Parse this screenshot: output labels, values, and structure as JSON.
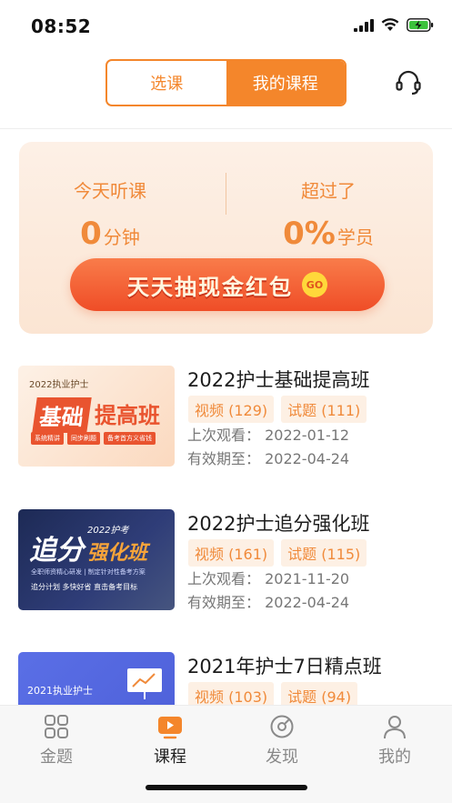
{
  "status_bar": {
    "time": "08:52"
  },
  "header": {
    "tabs": [
      {
        "label": "选课",
        "active": false
      },
      {
        "label": "我的课程",
        "active": true
      }
    ],
    "support_icon": "headset-icon"
  },
  "stats": {
    "today_label": "今天听课",
    "today_value": "0",
    "today_unit": "分钟",
    "beat_label": "超过了",
    "beat_value": "0%",
    "beat_unit": "学员",
    "cta_label": "天天抽现金红包",
    "cta_badge": "GO"
  },
  "courses": [
    {
      "title": "2022护士基础提高班",
      "video_tag": "视频 (129)",
      "quiz_tag": "试题 (111)",
      "last_watched": "上次观看： 2022-01-12",
      "expires": "有效期至： 2022-04-24",
      "thumb": {
        "top": "2022执业护士",
        "big_a": "基础",
        "big_b": "提高班",
        "pills": [
          "系统精讲",
          "同步刷题",
          "备考首方义省钱"
        ]
      }
    },
    {
      "title": "2022护士追分强化班",
      "video_tag": "视频 (161)",
      "quiz_tag": "试题 (115)",
      "last_watched": "上次观看： 2021-11-20",
      "expires": "有效期至： 2022-04-24",
      "thumb": {
        "small": "2022护考",
        "big_a": "追分",
        "big_b": "强化班",
        "line_a": "全职师资精心研发 | 制定针对性备考方案",
        "line_b": "追分计划 多快好省 直击备考目标"
      }
    },
    {
      "title": "2021年护士7日精点班",
      "video_tag": "视频 (103)",
      "quiz_tag": "试题 (94)",
      "thumb": {
        "small": "2021执业护士"
      }
    }
  ],
  "tab_bar": {
    "items": [
      {
        "label": "金题",
        "icon": "grid-icon",
        "active": false
      },
      {
        "label": "课程",
        "icon": "play-screen-icon",
        "active": true
      },
      {
        "label": "发现",
        "icon": "compass-icon",
        "active": false
      },
      {
        "label": "我的",
        "icon": "person-icon",
        "active": false
      }
    ]
  },
  "colors": {
    "accent": "#f4862b",
    "tag_bg": "#fdf0e4",
    "cta": "#ef4d27"
  }
}
